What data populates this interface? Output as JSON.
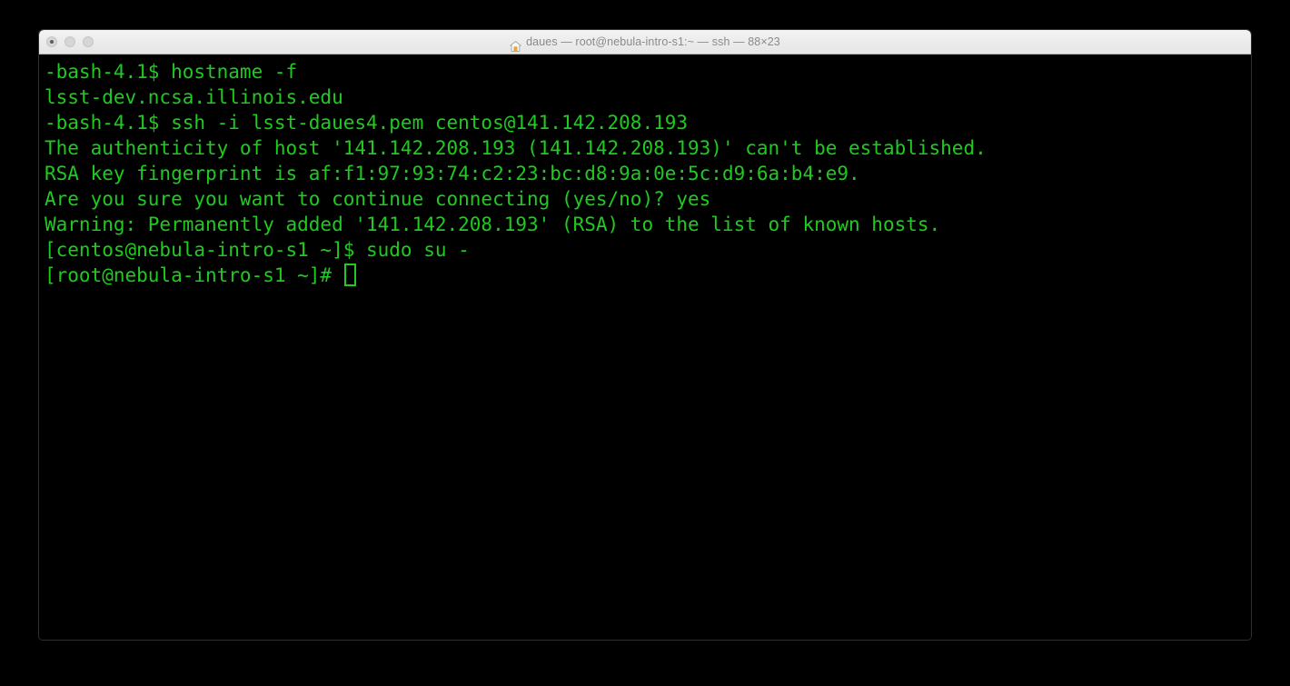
{
  "window": {
    "title": "daues — root@nebula-intro-s1:~ — ssh — 88×23",
    "title_icon": "home-icon",
    "traffic_lights": [
      {
        "name": "close-button",
        "state": "inactive-hovered"
      },
      {
        "name": "minimize-button",
        "state": "inactive"
      },
      {
        "name": "zoom-button",
        "state": "inactive"
      }
    ],
    "size_label": "88×23"
  },
  "theme": {
    "background": "#000000",
    "foreground": "#1ecb1e",
    "titlebar_background": "#ebebeb",
    "titlebar_text": "#8a8a8a",
    "cursor": "#1ecb1e",
    "window_border": "#2f2f2f"
  },
  "terminal": {
    "cursor": "▯",
    "lines": [
      "-bash-4.1$ hostname -f",
      "lsst-dev.ncsa.illinois.edu",
      "-bash-4.1$ ssh -i lsst-daues4.pem centos@141.142.208.193",
      "The authenticity of host '141.142.208.193 (141.142.208.193)' can't be established.",
      "RSA key fingerprint is af:f1:97:93:74:c2:23:bc:d8:9a:0e:5c:d9:6a:b4:e9.",
      "Are you sure you want to continue connecting (yes/no)? yes",
      "Warning: Permanently added '141.142.208.193' (RSA) to the list of known hosts.",
      "[centos@nebula-intro-s1 ~]$ sudo su -",
      "[root@nebula-intro-s1 ~]# "
    ]
  }
}
